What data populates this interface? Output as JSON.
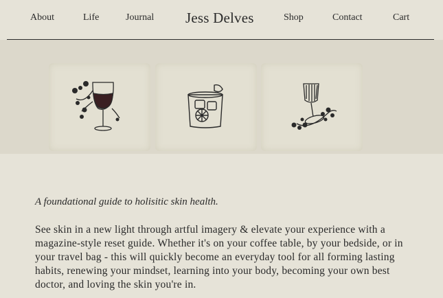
{
  "nav": {
    "about": "About",
    "life": "Life",
    "journal": "Journal",
    "brand": "Jess Delves",
    "shop": "Shop",
    "contact": "Contact",
    "cart": "Cart"
  },
  "hero": {
    "tiles": [
      {
        "icon": "wine-glass-flowers-icon"
      },
      {
        "icon": "cocktail-glass-citrus-icon"
      },
      {
        "icon": "tipped-glass-berries-icon"
      }
    ]
  },
  "content": {
    "tagline": "A foundational guide to holisitic skin health.",
    "paragraph": "See skin in a new light through artful imagery & elevate your experience with a magazine-style reset guide. Whether it's on your coffee table, by your bedside, or in your travel bag - this will quickly become an everyday tool for all forming lasting habits, renewing your mindset, learning into your body, becoming your own best doctor, and loving the skin you're in."
  },
  "colors": {
    "background": "#e6e3d8",
    "hero_background": "#dcd8cb",
    "text": "#2a2a2a"
  }
}
